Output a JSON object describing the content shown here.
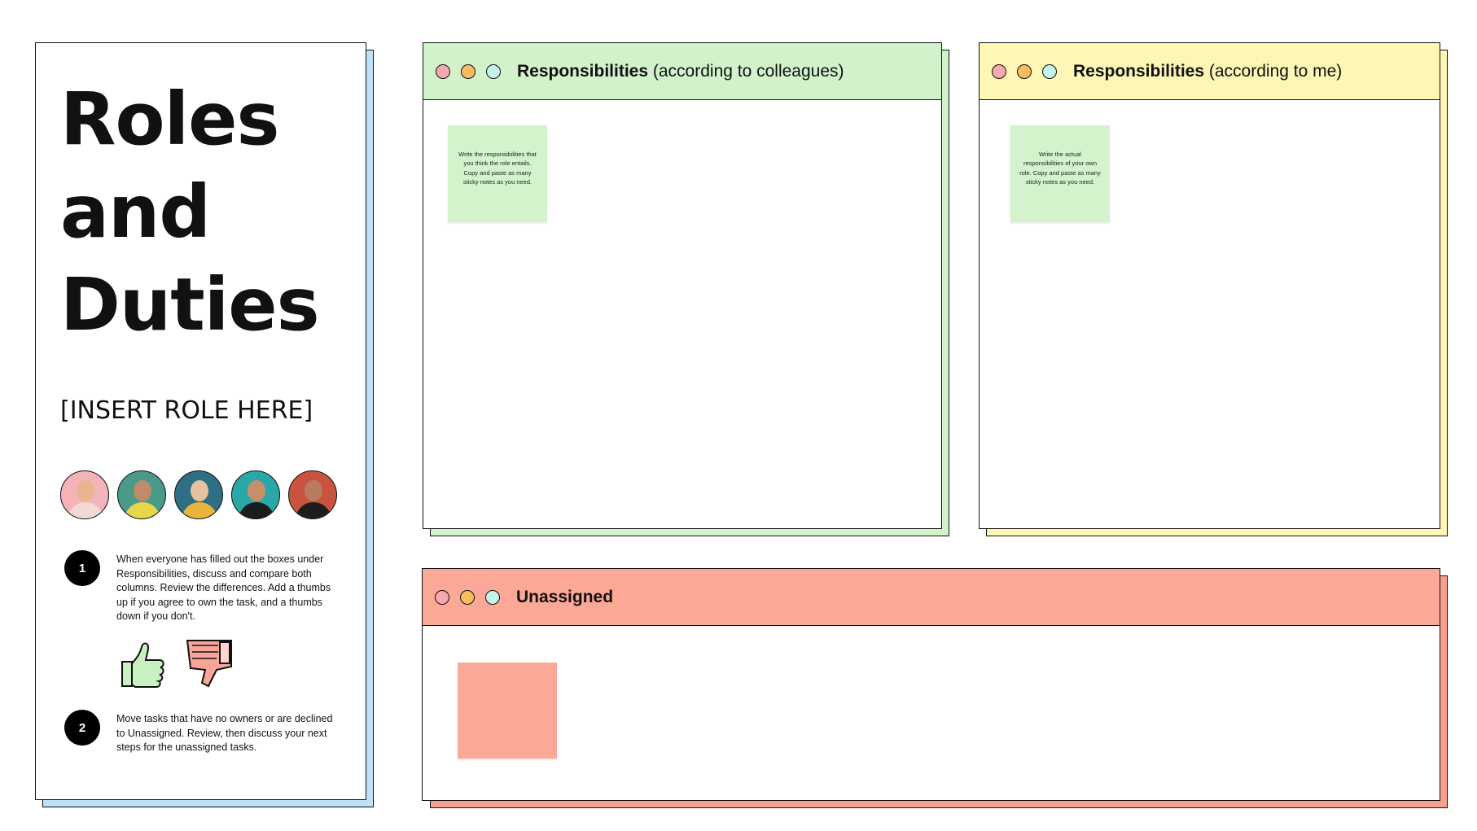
{
  "info_panel": {
    "title": "Roles and Duties",
    "role_placeholder": "[INSERT ROLE HERE]",
    "avatars": [
      {
        "name": "avatar-1",
        "bg": "#f4b3b8"
      },
      {
        "name": "avatar-2",
        "bg": "#4a9a89"
      },
      {
        "name": "avatar-3",
        "bg": "#2e6f86"
      },
      {
        "name": "avatar-4",
        "bg": "#2aa7a7"
      },
      {
        "name": "avatar-5",
        "bg": "#c9533f"
      }
    ],
    "step1": {
      "number": "1",
      "text": "When everyone has filled out the boxes under Responsibilities, discuss and compare both columns. Review the differences. Add a thumbs up if you agree to own the task, and a thumbs down if you don't."
    },
    "step2": {
      "number": "2",
      "text": "Move tasks that have no owners or are declined to Unassigned. Review, then discuss your next steps for the unassigned tasks."
    },
    "thumbs": [
      "thumbs-up-icon",
      "thumbs-down-icon"
    ]
  },
  "columns": {
    "colleagues": {
      "title_bold": "Responsibilities",
      "title_rest": " (according to colleagues)",
      "sticky_text": "Write the responsibilities that you think the role entails. Copy and paste as many sticky notes as you need."
    },
    "me": {
      "title_bold": "Responsibilities",
      "title_rest": " (according to me)",
      "sticky_text": "Write the actual responsibilities of your own role. Copy and paste as many sticky notes as you need."
    },
    "unassigned": {
      "title_bold": "Unassigned",
      "sticky_text": ""
    }
  },
  "colors": {
    "info_shadow": "#bfe0f6",
    "colleagues": "#d2f2cb",
    "me": "#fdf6b4",
    "unassigned": "#fca897",
    "dot_pink": "#f7a8b0",
    "dot_orange": "#f7bd60",
    "dot_cyan": "#c5f2ea"
  }
}
